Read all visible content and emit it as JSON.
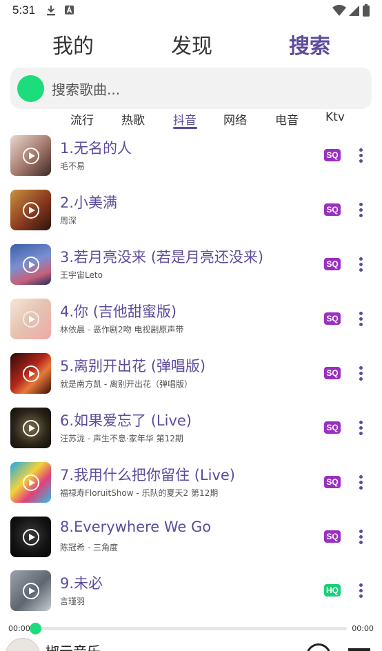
{
  "status": {
    "time": "5:31"
  },
  "top_tabs": [
    "我的",
    "发现",
    "搜索"
  ],
  "search": {
    "placeholder": "搜索歌曲..."
  },
  "categories": [
    "流行",
    "热歌",
    "抖音",
    "网络",
    "电音",
    "Ktv"
  ],
  "songs": [
    {
      "title": "1.无名的人",
      "subtitle": "毛不易",
      "quality": "SQ"
    },
    {
      "title": "2.小美满",
      "subtitle": "周深",
      "quality": "SQ"
    },
    {
      "title": "3.若月亮没来 (若是月亮还没来)",
      "subtitle": "王宇宙Leto",
      "quality": "SQ"
    },
    {
      "title": "4.你 (吉他甜蜜版)",
      "subtitle": "林依晨 - 恶作剧2吻 电视剧原声带",
      "quality": "SQ"
    },
    {
      "title": "5.离别开出花 (弹唱版)",
      "subtitle": "就是南方凯 - 离别开出花（弹唱版）",
      "quality": "SQ"
    },
    {
      "title": "6.如果爱忘了 (Live)",
      "subtitle": "汪苏泷 - 声生不息·家年华 第12期",
      "quality": "SQ"
    },
    {
      "title": "7.我用什么把你留住 (Live)",
      "subtitle": "福禄寿FloruitShow - 乐队的夏天2 第12期",
      "quality": "SQ"
    },
    {
      "title": "8.Everywhere We Go",
      "subtitle": "陈冠希 - 三角度",
      "quality": "SQ"
    },
    {
      "title": "9.未必",
      "subtitle": "言瑾羽",
      "quality": "HQ"
    }
  ],
  "player": {
    "name": "椒云音乐",
    "time_current": "00:00",
    "time_total": "00:00",
    "progress": 0
  },
  "colors": {
    "accent": "#5e4b9c",
    "green": "#1ddc7b",
    "sq_badge": "#9b2fc1",
    "hq_badge": "#19d07a"
  },
  "icons": {
    "download": "download-icon",
    "notification": "a-notification-icon",
    "wifi": "wifi-icon",
    "signal": "signal-icon",
    "battery": "battery-icon",
    "play": "play-icon",
    "more": "more-vertical-icon"
  }
}
